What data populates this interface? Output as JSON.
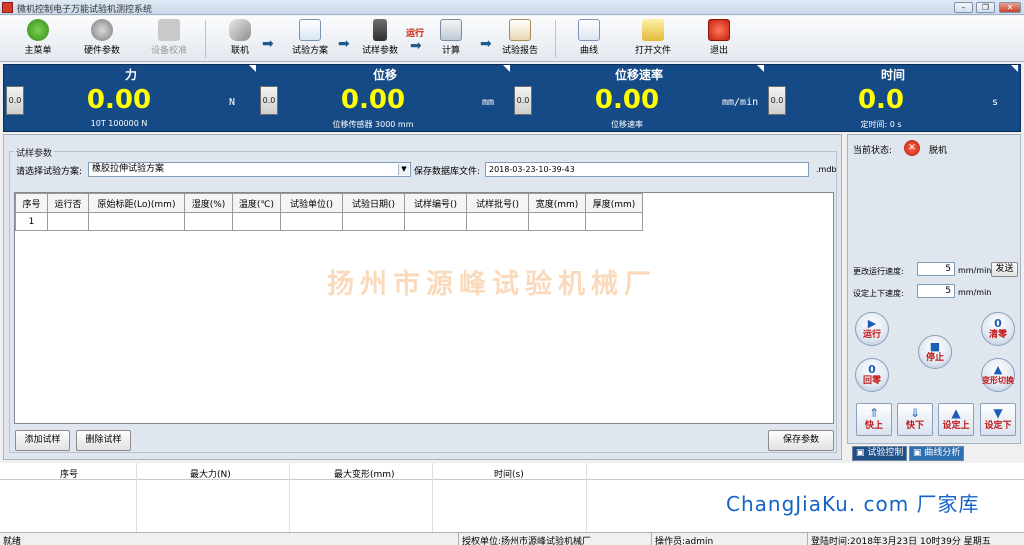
{
  "window": {
    "title": "微机控制电子万能试验机测控系统",
    "min": "–",
    "max": "❐",
    "close": "✕"
  },
  "toolbar": {
    "main_menu": "主菜单",
    "hardware": "硬件参数",
    "calibrate": "设备校准",
    "connect": "联机",
    "plan": "试验方案",
    "sample_params": "试样参数",
    "run_tag": "运行",
    "calc": "计算",
    "report": "试验报告",
    "curve": "曲线",
    "open_file": "打开文件",
    "exit": "退出"
  },
  "readouts": {
    "force": {
      "title": "力",
      "value": "0.00",
      "unit": "N",
      "sub": "10T 100000 N",
      "zero": "0.0"
    },
    "disp": {
      "title": "位移",
      "value": "0.00",
      "unit": "mm",
      "sub": "位移传感器 3000 mm",
      "zero": "0.0"
    },
    "speed": {
      "title": "位移速率",
      "value": "0.00",
      "unit": "mm/min",
      "sub": "位移速率",
      "zero": "0.0"
    },
    "time": {
      "title": "时间",
      "value": "0.0",
      "unit": "s",
      "sub": "定时间: 0 s",
      "zero": "0.0"
    }
  },
  "params": {
    "legend": "试样参数",
    "plan_label": "请选择试验方案:",
    "plan_value": "橡胶拉伸试验方案",
    "db_label": "保存数据库文件:",
    "db_value": "2018-03-23-10-39-43",
    "db_ext": ".mdb",
    "columns": [
      "序号",
      "运行否",
      "原始标距(Lo)(mm)",
      "湿度(%)",
      "温度(℃)",
      "试验单位()",
      "试验日期()",
      "试样编号()",
      "试样批号()",
      "宽度(mm)",
      "厚度(mm)"
    ],
    "rows": [
      [
        "1",
        "",
        "",
        "",
        "",
        "",
        "",
        "",
        "",
        "",
        ""
      ]
    ],
    "watermark": "扬州市源峰试验机械厂",
    "add_btn": "添加试样",
    "del_btn": "删除试样",
    "save_btn": "保存参数"
  },
  "results": {
    "columns": [
      "序号",
      "最大力(N)",
      "最大变形(mm)",
      "时间(s)"
    ],
    "brand": "ChangJiaKu. com 厂家库"
  },
  "control": {
    "state_label": "当前状态:",
    "state_value": "脱机",
    "speed_label": "更改运行速度:",
    "speed_value": "5",
    "speed_unit": "mm/min",
    "send": "发送",
    "updown_label": "设定上下速度:",
    "updown_value": "5",
    "updown_unit": "mm/min",
    "run": "运行",
    "zero": "清零",
    "stop": "停止",
    "home": "回零",
    "switch": "变形切换",
    "fast_up": "快上",
    "fast_down": "快下",
    "set_up": "设定上",
    "set_down": "设定下",
    "tab_test": "试验控制",
    "tab_curve": "曲线分析"
  },
  "status": {
    "ready": "就绪",
    "licensee": "授权单位:扬州市源峰试验机械厂",
    "operator": "操作员:admin",
    "login": "登陆时间:2018年3月23日 10时39分 星期五"
  }
}
